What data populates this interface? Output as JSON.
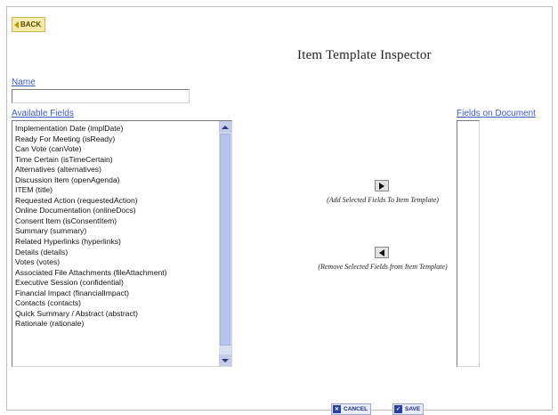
{
  "header": {
    "back_label": "BACK",
    "title": "Item Template Inspector"
  },
  "name_field": {
    "label": "Name",
    "value": ""
  },
  "available_fields": {
    "label": "Available Fields",
    "items": [
      "Implementation Date (implDate)",
      "Ready For Meeting (isReady)",
      "Can Vote (canVote)",
      "Time Certain (isTimeCertain)",
      "Alternatives (alternatives)",
      "Discussion Item (openAgenda)",
      "ITEM (title)",
      "Requested Action (requestedAction)",
      "Online Documentation (onlineDocs)",
      "Consent Item (isConsentItem)",
      "Summary (summary)",
      "Related Hyperlinks (hyperlinks)",
      "Details (details)",
      "Votes (votes)",
      "Associated File Attachments (fileAttachment)",
      "Executive Session (confidential)",
      "Financial Impact (financialImpact)",
      "Contacts (contacts)",
      "Quick Summary / Abstract (abstract)",
      "Rationale (rationale)"
    ]
  },
  "document_fields": {
    "label": "Fields on Document",
    "items": []
  },
  "actions": {
    "add_caption": "(Add Selected Fields To Item Template)",
    "remove_caption": "(Remove Selected Fields from Item Template)"
  },
  "footer": {
    "cancel_label": "CANCEL",
    "save_label": "SAVE"
  }
}
